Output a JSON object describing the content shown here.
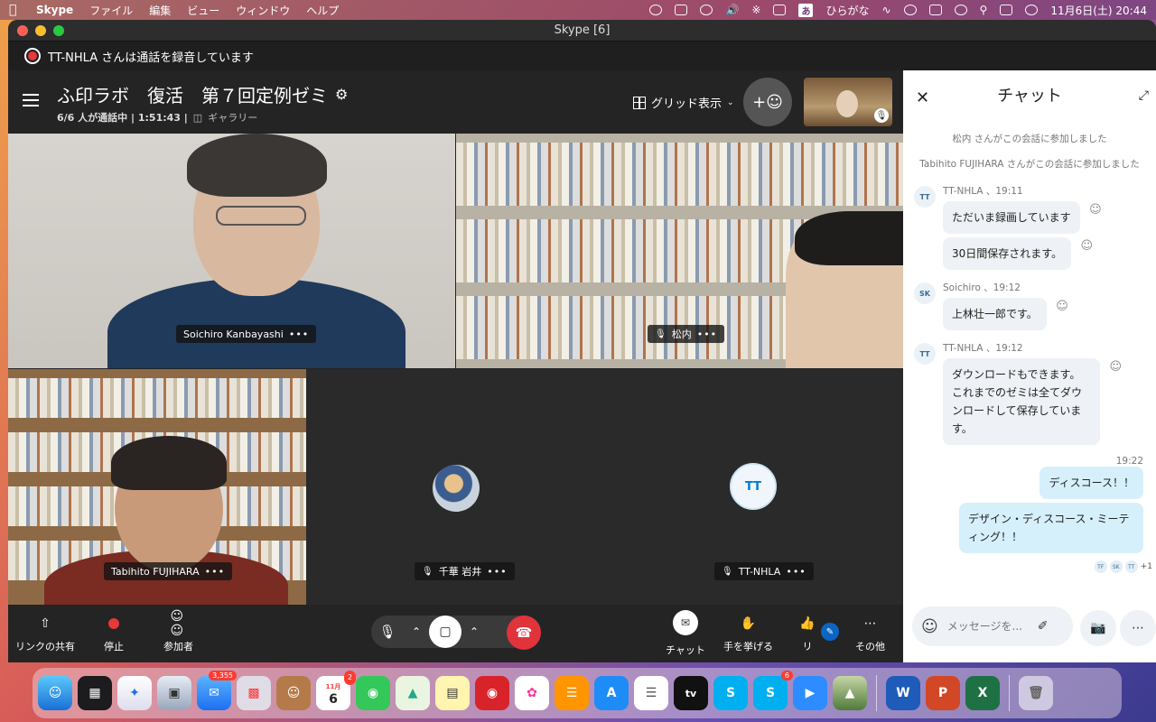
{
  "menubar": {
    "app_name": "Skype",
    "menus": [
      "ファイル",
      "編集",
      "ビュー",
      "ウィンドウ",
      "ヘルプ"
    ],
    "input_method_box": "あ",
    "input_method": "ひらがな",
    "datetime": "11月6日(土)  20:44"
  },
  "window": {
    "title": "Skype [6]",
    "recording_notice": "TT-NHLA さんは通話を録音しています"
  },
  "call": {
    "title": "ふ印ラボ　復活　第７回定例ゼミ",
    "participants_count": "6/6",
    "participants_text": "人が通話中",
    "duration": "1:51:43",
    "view_mode": "ギャラリー",
    "grid_button": "グリッド表示",
    "tiles": [
      {
        "name": "Soichiro Kanbayashi",
        "muted": false
      },
      {
        "name": "松内",
        "muted": true
      },
      {
        "name": "Tabihito FUJIHARA",
        "muted": false
      },
      {
        "name": "千華 岩井",
        "muted": true
      },
      {
        "name": "TT-NHLA",
        "muted": true,
        "initials": "TT"
      }
    ],
    "more_glyph": "•••"
  },
  "controls": {
    "share_link": "リンクの共有",
    "stop": "停止",
    "participants": "参加者",
    "chat": "チャット",
    "raise_hand": "手を挙げる",
    "react": "リ",
    "more": "その他"
  },
  "chat": {
    "title": "チャット",
    "system_messages": [
      "松内 さんがこの会話に参加しました",
      "Tabihito FUJIHARA さんがこの会話に参加しました"
    ],
    "groups": [
      {
        "initials": "TT",
        "sender": "TT-NHLA 、19:11",
        "messages": [
          "ただいま録画しています",
          "30日間保存されます。"
        ]
      },
      {
        "initials": "SK",
        "sender": "Soichiro 、19:12",
        "messages": [
          "上林壮一郎です。"
        ]
      },
      {
        "initials": "TT",
        "sender": "TT-NHLA 、19:12",
        "messages": [
          "ダウンロードもできます。これまでのゼミは全てダウンロードして保存しています。"
        ]
      }
    ],
    "outgoing_time": "19:22",
    "outgoing": [
      "ディスコース！！",
      "デザイン・ディスコース・ミーティング！！"
    ],
    "read_receipts": [
      "TF",
      "SK",
      "TT"
    ],
    "read_extra": "+1",
    "input_placeholder": "メッセージを..."
  },
  "dock": {
    "badges": {
      "mail": "3,355",
      "calendar": "2",
      "skype": "6"
    },
    "calendar_month": "11月",
    "calendar_day": "6"
  }
}
